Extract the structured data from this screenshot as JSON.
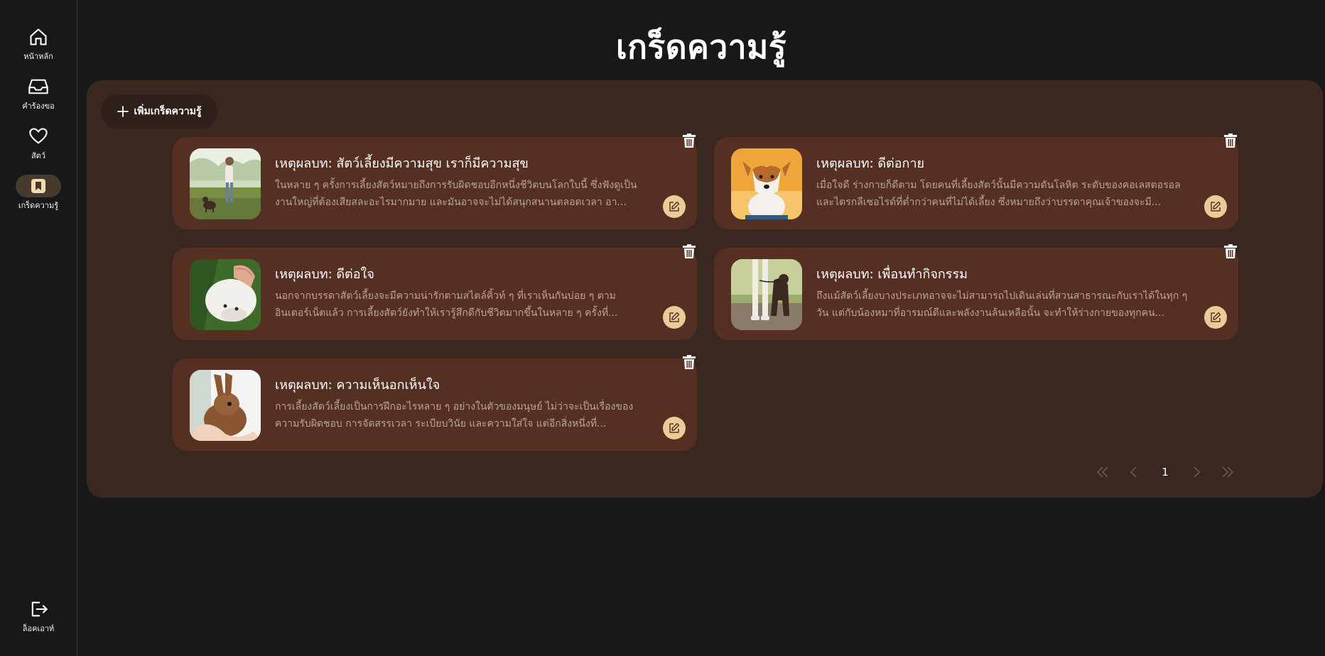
{
  "nav": {
    "items": [
      {
        "label": "หน้าหลัก",
        "icon": "home-icon"
      },
      {
        "label": "คำร้องขอ",
        "icon": "inbox-icon"
      },
      {
        "label": "สัตว์",
        "icon": "heart-icon"
      },
      {
        "label": "เกร็ดความรู้",
        "icon": "bookmark-icon",
        "active": true
      }
    ],
    "logout_label": "ล็อคเอาท์"
  },
  "page": {
    "title": "เกร็ดความรู้",
    "add_button_label": "เพิ่มเกร็ดความรู้"
  },
  "cards": [
    {
      "title": "เหตุผลบท: สัตว์เลี้ยงมีความสุข เราก็มีความสุข",
      "text": "ในหลาย ๆ ครั้งการเลี้ยงสัตว์หมายถึงการรับผิดชอบอีกหนึ่งชีวิตบนโลกใบนี้ ซึ่งฟังดูเป็นงานใหญ่ที่ต้องเสียสละอะไรมากมาย และมันอาจจะไม่ได้สนุกสนานตลอดเวลา อา...",
      "image": "woman-walking-dog-in-park"
    },
    {
      "title": "เหตุผลบท: ดีต่อกาย",
      "text": "เมื่อใจดี ร่างกายก็ดีตาม โดยคนที่เลี้ยงสัตว์นั้นมีความดันโลหิต ระดับของคอเลสตอรอล และไตรกลีเซอไรด์ที่ต่ำกว่าคนที่ไม่ได้เลี้ยง ซึ่งหมายถึงว่าบรรดาคุณเจ้าของจะมี...",
      "image": "jack-russell-dog"
    },
    {
      "title": "เหตุผลบท: ดีต่อใจ",
      "text": "นอกจากบรรดาสัตว์เลี้ยงจะมีความน่ารักตามสไตล์คิ้วท์ ๆ ที่เราเห็นกันบ่อย ๆ ตามอินเตอร์เน็ตแล้ว การเลี้ยงสัตว์ยังทำให้เรารู้สึกดีกับชีวิตมากขึ้นในหลาย ๆ ครั้งที่...",
      "image": "hand-petting-white-cat"
    },
    {
      "title": "เหตุผลบท: เพื่อนทำกิจกรรม",
      "text": "ถึงแม้สัตว์เลี้ยงบางประเภทอาจจะไม่สามารถไปเดินเล่นที่สวนสาธารณะกับเราได้ในทุก ๆ วัน แต่กับน้องหมาที่อารมณ์ดีและพลังงานล้นเหลือนั้น จะทำให้ร่างกายของทุกคน...",
      "image": "person-walking-dark-dog"
    },
    {
      "title": "เหตุผลบท: ความเห็นอกเห็นใจ",
      "text": "การเลี้ยงสัตว์เลี้ยงเป็นการฝึกอะไรหลาย ๆ อย่างในตัวของมนุษย์ ไม่ว่าจะเป็นเรื่องของความรับผิดชอบ การจัดสรรเวลา ระเบียบวินัย และความใส่ใจ แต่อีกสิ่งหนึ่งที่...",
      "image": "brown-rabbit-in-hands"
    }
  ],
  "pagination": {
    "current_page": "1"
  },
  "colors": {
    "background": "#18181a",
    "panel": "#3a2720",
    "card": "#542f22",
    "edit_button": "#e9cc96",
    "nav_active": "#453a2b"
  }
}
